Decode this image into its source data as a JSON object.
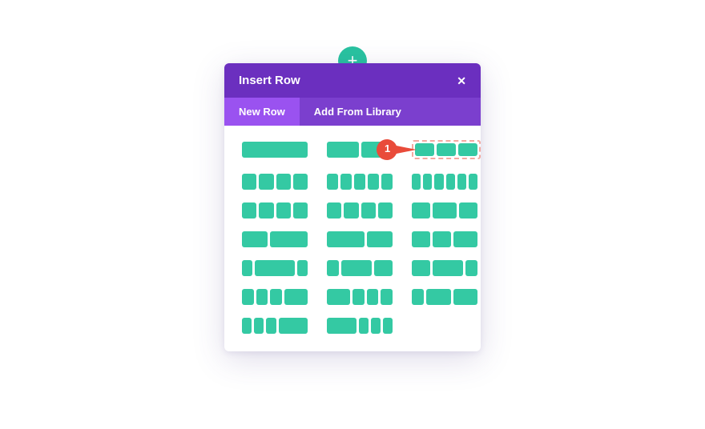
{
  "header": {
    "title": "Insert Row"
  },
  "tabs": {
    "new_row": "New Row",
    "add_library": "Add From Library",
    "active": 0
  },
  "callout": {
    "number": "1"
  },
  "layouts": [
    {
      "cols": [
        1
      ],
      "selected": false
    },
    {
      "cols": [
        1,
        1
      ],
      "selected": false
    },
    {
      "cols": [
        1,
        1,
        1
      ],
      "selected": true
    },
    {
      "cols": [
        1,
        1,
        1,
        1
      ],
      "selected": false
    },
    {
      "cols": [
        1,
        1,
        1,
        1,
        1
      ],
      "selected": false
    },
    {
      "cols": [
        1,
        1,
        1,
        1,
        1,
        1
      ],
      "selected": false
    },
    {
      "cols": [
        1,
        1,
        1,
        1
      ],
      "selected": false
    },
    {
      "cols": [
        1,
        1,
        1,
        1
      ],
      "selected": false
    },
    {
      "cols": [
        3,
        4,
        3
      ],
      "selected": false
    },
    {
      "cols": [
        2,
        3
      ],
      "selected": false
    },
    {
      "cols": [
        3,
        2
      ],
      "selected": false
    },
    {
      "cols": [
        3,
        3,
        4
      ],
      "selected": false
    },
    {
      "cols": [
        2,
        8,
        2
      ],
      "selected": false
    },
    {
      "cols": [
        2,
        5,
        3
      ],
      "selected": false
    },
    {
      "cols": [
        3,
        5,
        2
      ],
      "selected": false
    },
    {
      "cols": [
        2,
        2,
        2,
        4
      ],
      "selected": false
    },
    {
      "cols": [
        4,
        2,
        2,
        2
      ],
      "selected": false
    },
    {
      "cols": [
        2,
        4,
        4
      ],
      "selected": false
    },
    {
      "cols": [
        1,
        1,
        1,
        3
      ],
      "selected": false
    },
    {
      "cols": [
        3,
        1,
        1,
        1
      ],
      "selected": false
    }
  ]
}
